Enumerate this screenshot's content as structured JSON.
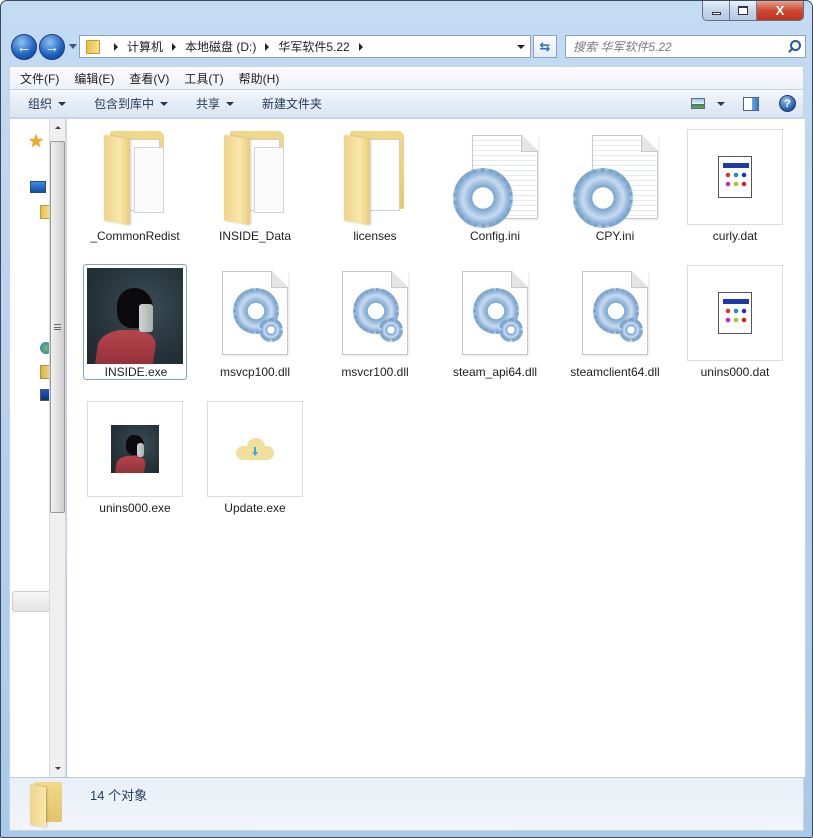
{
  "window": {
    "controls": {
      "minimize": "minimize",
      "maximize": "maximize",
      "close": "X"
    }
  },
  "navigation": {
    "back_icon": "back-arrow-icon",
    "forward_icon": "forward-arrow-icon",
    "breadcrumbs": [
      "计算机",
      "本地磁盘 (D:)",
      "华军软件5.22"
    ],
    "refresh_glyph": "⇆",
    "search": {
      "placeholder": "搜索 华军软件5.22",
      "value": ""
    }
  },
  "menubar": {
    "items": [
      "文件(F)",
      "编辑(E)",
      "查看(V)",
      "工具(T)",
      "帮助(H)"
    ]
  },
  "commandbar": {
    "organize": "组织",
    "include_in_library": "包含到库中",
    "share": "共享",
    "new_folder": "新建文件夹",
    "help_glyph": "?"
  },
  "files": [
    {
      "name": "_CommonRedist",
      "type": "folder"
    },
    {
      "name": "INSIDE_Data",
      "type": "folder"
    },
    {
      "name": "licenses",
      "type": "folder"
    },
    {
      "name": "Config.ini",
      "type": "ini"
    },
    {
      "name": "CPY.ini",
      "type": "ini"
    },
    {
      "name": "curly.dat",
      "type": "dat"
    },
    {
      "name": "INSIDE.exe",
      "type": "exe-game",
      "selected": true
    },
    {
      "name": "msvcp100.dll",
      "type": "dll"
    },
    {
      "name": "msvcr100.dll",
      "type": "dll"
    },
    {
      "name": "steam_api64.dll",
      "type": "dll"
    },
    {
      "name": "steamclient64.dll",
      "type": "dll"
    },
    {
      "name": "unins000.dat",
      "type": "dat"
    },
    {
      "name": "unins000.exe",
      "type": "exe-game-small"
    },
    {
      "name": "Update.exe",
      "type": "exe-cloud"
    }
  ],
  "status": {
    "object_count": "14 个对象"
  }
}
